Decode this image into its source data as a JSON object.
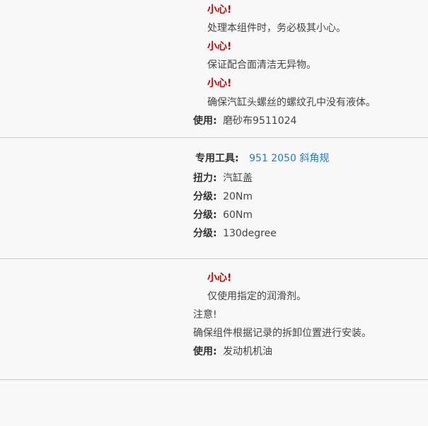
{
  "section1": {
    "caution1_title": "小心!",
    "caution1_text": "处理本组件时，务必极其小心。",
    "caution2_title": "小心!",
    "caution2_text": "保证配合面清洁无异物。",
    "caution3_title": "小心!",
    "caution3_text": "确保汽缸头螺丝的螺纹孔中没有液体。",
    "use_label": "使用:",
    "use_value": "磨砂布9511024"
  },
  "section2": {
    "tool_label": "专用工具:",
    "tool_link": "951 2050 斜角规",
    "torque_label": "扭力:",
    "torque_value": "汽缸盖",
    "grade1_label": "分级:",
    "grade1_value": "20Nm",
    "grade2_label": "分级:",
    "grade2_value": "60Nm",
    "grade3_label": "分级:",
    "grade3_value": "130degree"
  },
  "section3": {
    "caution_title": "小心!",
    "caution_text": "仅使用指定的润滑剂。",
    "note_title": "注意!",
    "note_text": "确保组件根据记录的拆卸位置进行安装。",
    "use_label": "使用:",
    "use_value": "发动机机油"
  }
}
